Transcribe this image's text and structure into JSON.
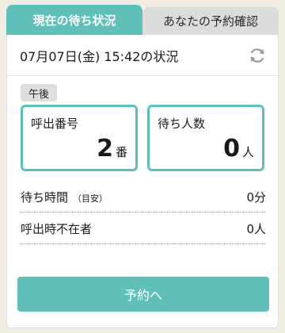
{
  "tabs": {
    "current_status": "現在の待ち状況",
    "my_reservation": "あなたの予約確認"
  },
  "status": {
    "datetime_label": "07月07日(金) 15:42の状況",
    "period_badge": "午後",
    "refresh_icon": "refresh-icon"
  },
  "cards": {
    "call_number_label": "呼出番号",
    "call_number_value": "2",
    "call_number_unit": "番",
    "waiting_label": "待ち人数",
    "waiting_value": "0",
    "waiting_unit": "人"
  },
  "info": {
    "wait_time_label": "待ち時間",
    "wait_time_sub": "（目安）",
    "wait_time_value": "0分",
    "absent_label": "呼出時不在者",
    "absent_value": "0人"
  },
  "actions": {
    "reserve_label": "予約へ"
  },
  "colors": {
    "accent": "#5ec0b8",
    "background": "#f1ede3"
  }
}
